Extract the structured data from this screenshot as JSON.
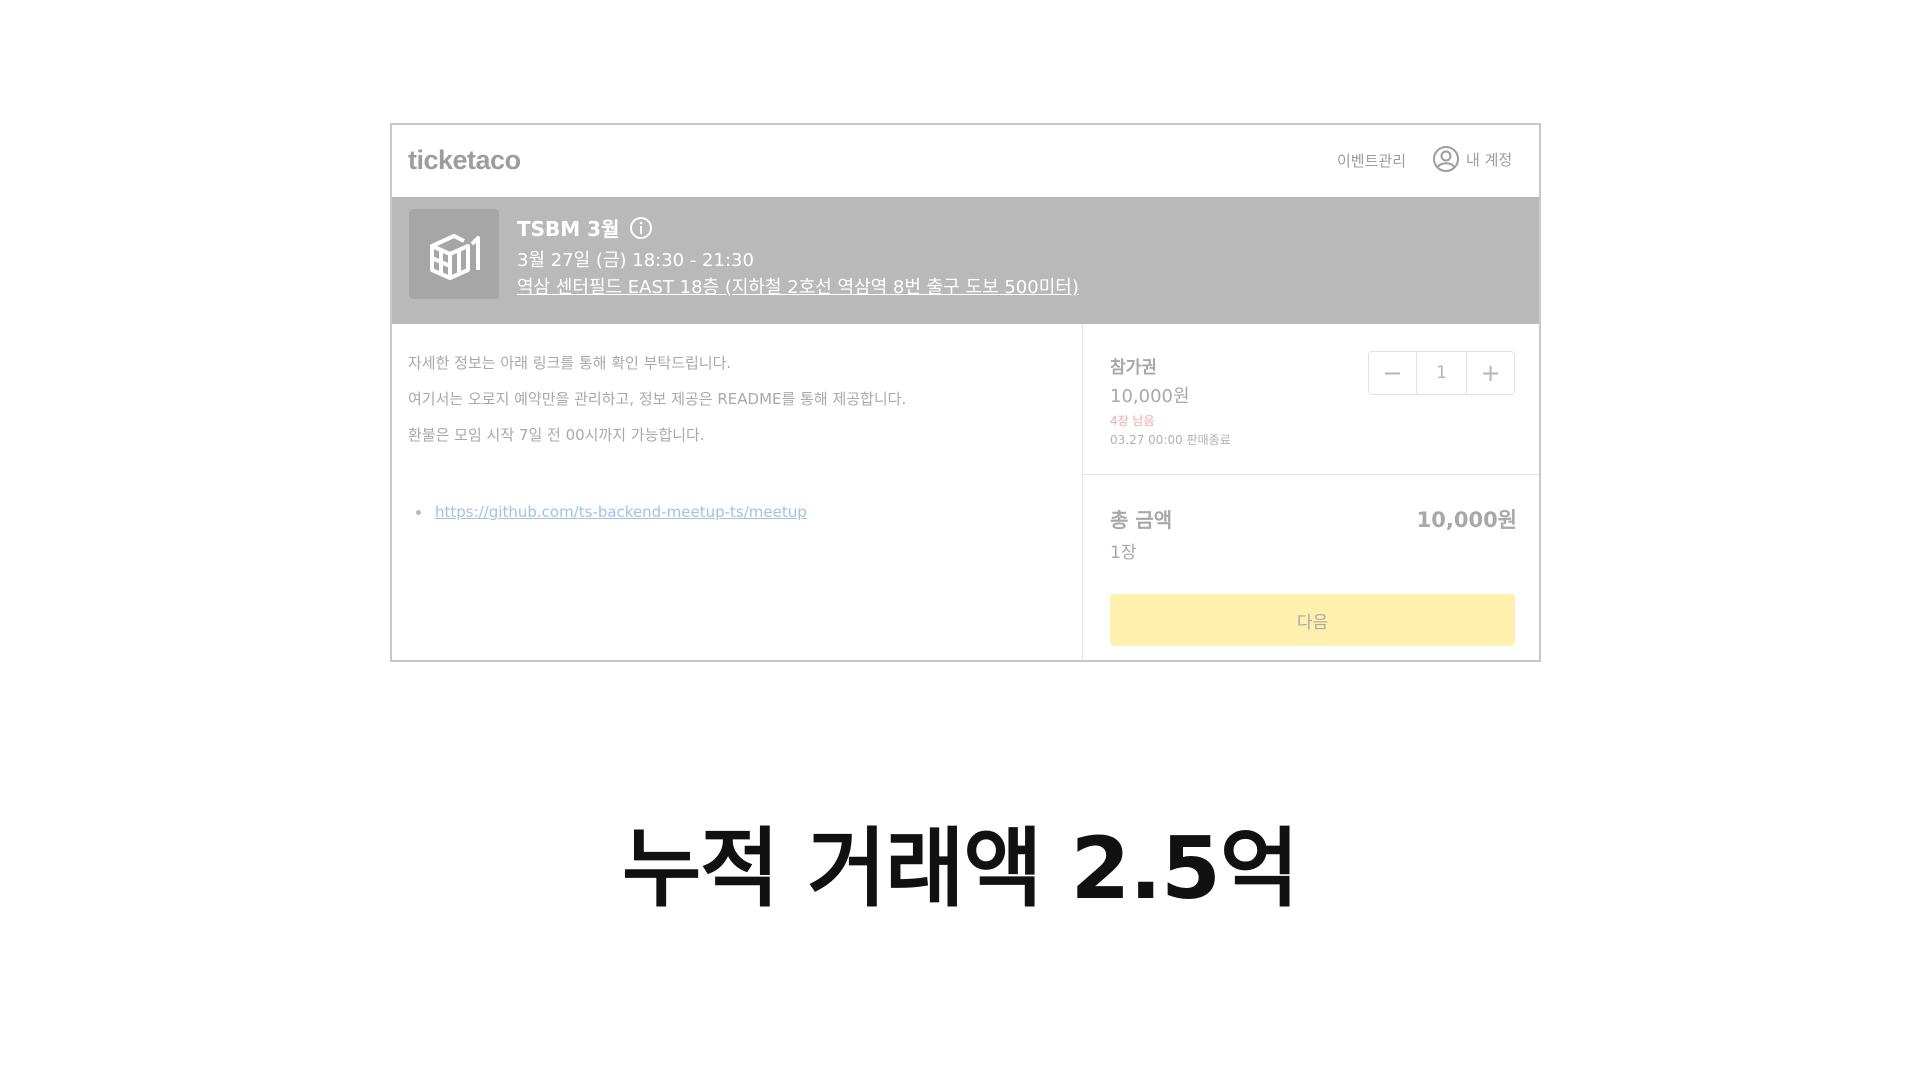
{
  "header": {
    "logo": "ticketaco",
    "nav_events": "이벤트관리",
    "account_label": "내 계정",
    "account_icon": "user-circle-icon"
  },
  "event": {
    "title": "TSBM 3월",
    "info_icon": "info-icon",
    "date": "3월 27일 (금) 18:30 - 21:30",
    "venue": "역삼 센터필드 EAST 18층 (지하철 2호선 역삼역 8번 출구 도보 500미터)"
  },
  "description": {
    "lines": [
      "자세한 정보는 아래 링크를 통해 확인 부탁드립니다.",
      "여기서는 오로지 예약만을 관리하고, 정보 제공은 README를 통해 제공합니다.",
      "환불은 모임 시작 7일 전 00시까지 가능합니다."
    ],
    "link": "https://github.com/ts-backend-meetup-ts/meetup"
  },
  "ticket": {
    "name": "참가권",
    "price": "10,000원",
    "remaining": "4장 남음",
    "sale_end": "03.27 00:00 판매종료",
    "quantity": "1",
    "minus_symbol": "−",
    "plus_symbol": "+"
  },
  "summary": {
    "total_label": "총 금액",
    "total_value": "10,000원",
    "count": "1장",
    "next_label": "다음"
  },
  "headline": "누적 거래액 2.5억",
  "colors": {
    "banner": "#b9b9b9",
    "next_button": "#fff1ad",
    "remaining": "#f3a7a7",
    "link": "#9ec2ea"
  }
}
